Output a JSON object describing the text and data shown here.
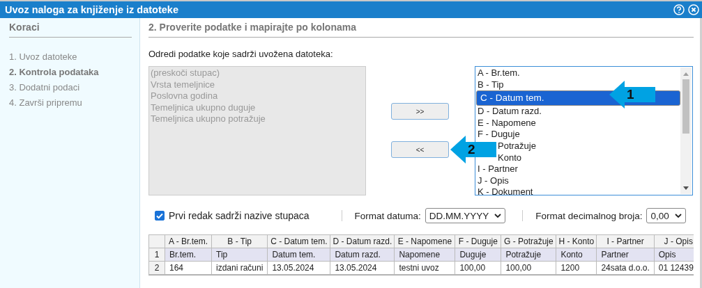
{
  "window": {
    "title": "Uvoz naloga za knjiženje iz datoteke"
  },
  "sidebar": {
    "heading": "Koraci",
    "steps": [
      {
        "label": "1. Uvoz datoteke",
        "selected": false
      },
      {
        "label": "2. Kontrola podataka",
        "selected": true
      },
      {
        "label": "3. Dodatni podaci",
        "selected": false
      },
      {
        "label": "4. Završi pripremu",
        "selected": false
      }
    ]
  },
  "main": {
    "heading": "2. Proverite podatke i mapirajte po kolonama",
    "instruction": "Odredi podatke koje sadrži uvožena datoteka:"
  },
  "available_fields": {
    "disabled": true,
    "items": [
      "(preskoči stupac)",
      "Vrsta temeljnice",
      "Poslovna godina",
      "Temeljnica ukupno duguje",
      "Temeljnica ukupno potražuje"
    ]
  },
  "move_buttons": [
    ">>",
    "<<"
  ],
  "file_columns": [
    {
      "label": "A - Br.tem.",
      "selected": false
    },
    {
      "label": "B - Tip",
      "selected": false
    },
    {
      "label": "C - Datum tem.",
      "selected": true
    },
    {
      "label": "D - Datum razd.",
      "selected": false
    },
    {
      "label": "E - Napomene",
      "selected": false
    },
    {
      "label": "F - Duguje",
      "selected": false
    },
    {
      "label": "Potražuje",
      "selected": false,
      "covered": true
    },
    {
      "label": "Konto",
      "selected": false,
      "covered": true
    },
    {
      "label": "I - Partner",
      "selected": false
    },
    {
      "label": "J - Opis",
      "selected": false
    },
    {
      "label": "K - Dokument",
      "selected": false
    }
  ],
  "callouts": [
    {
      "label": "1"
    },
    {
      "label": "2"
    }
  ],
  "options": {
    "header_row": {
      "label": "Prvi redak sadrži nazive stupaca",
      "checked": true
    },
    "date_format": {
      "label": "Format datuma:",
      "value": "DD.MM.YYYY"
    },
    "decimal_format": {
      "label": "Format decimalnog broja:",
      "value": "0,00"
    }
  },
  "table": {
    "columns": [
      "A - Br.tem.",
      "B - Tip",
      "C - Datum tem.",
      "D - Datum razd.",
      "E - Napomene",
      "F - Duguje",
      "G - Potražuje",
      "H - Konto",
      "I - Partner",
      "J - Opis"
    ],
    "rows": [
      {
        "number": "1",
        "kind": "header",
        "cells": [
          "Br.tem.",
          "Tip",
          "Datum tem.",
          "Datum razd.",
          "Napomene",
          "Duguje",
          "Potražuje",
          "Konto",
          "Partner",
          "Opis"
        ]
      },
      {
        "number": "2",
        "kind": "data",
        "cells": [
          "164",
          "izdani računi",
          "13.05.2024",
          "13.05.2024",
          "testni uvoz",
          "100,00",
          "100,00",
          "1200",
          "24sata d.o.o.",
          "01 12439"
        ]
      }
    ]
  }
}
